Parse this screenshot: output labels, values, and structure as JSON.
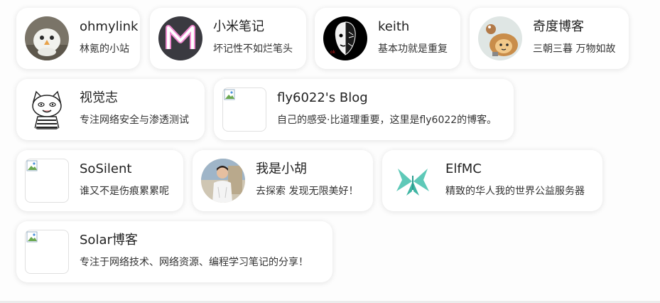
{
  "friends": [
    {
      "name": "ohmylink",
      "desc": "林氪的小站",
      "avatar": "white-bird-avatar"
    },
    {
      "name": "小米笔记",
      "desc": "坏记性不如烂笔头",
      "avatar": "letter-m-avatar"
    },
    {
      "name": "keith",
      "desc": "基本功就是重复",
      "avatar": "split-face-avatar"
    },
    {
      "name": "奇度博客",
      "desc": "三朝三暮 万物如故",
      "avatar": "cartoon-lion-avatar"
    },
    {
      "name": "视觉志",
      "desc": "专注网络安全与渗透测试",
      "avatar": "cartoon-cat-avatar"
    },
    {
      "name": "fly6022's Blog",
      "desc": "自己的感受·比道理重要，这里是fly6022的博客。",
      "avatar": "broken-image-icon"
    },
    {
      "name": "SoSilent",
      "desc": "谁又不是伤痕累累呢",
      "avatar": "broken-image-icon"
    },
    {
      "name": "我是小胡",
      "desc": "去探索 发现无限美好！",
      "avatar": "person-photo-avatar"
    },
    {
      "name": "ElfMC",
      "desc": "精致的华人我的世界公益服务器",
      "avatar": "butterfly-logo-avatar"
    },
    {
      "name": "Solar博客",
      "desc": "专注于网络技术、网络资源、编程学习笔记的分享！",
      "avatar": "broken-image-icon"
    }
  ]
}
